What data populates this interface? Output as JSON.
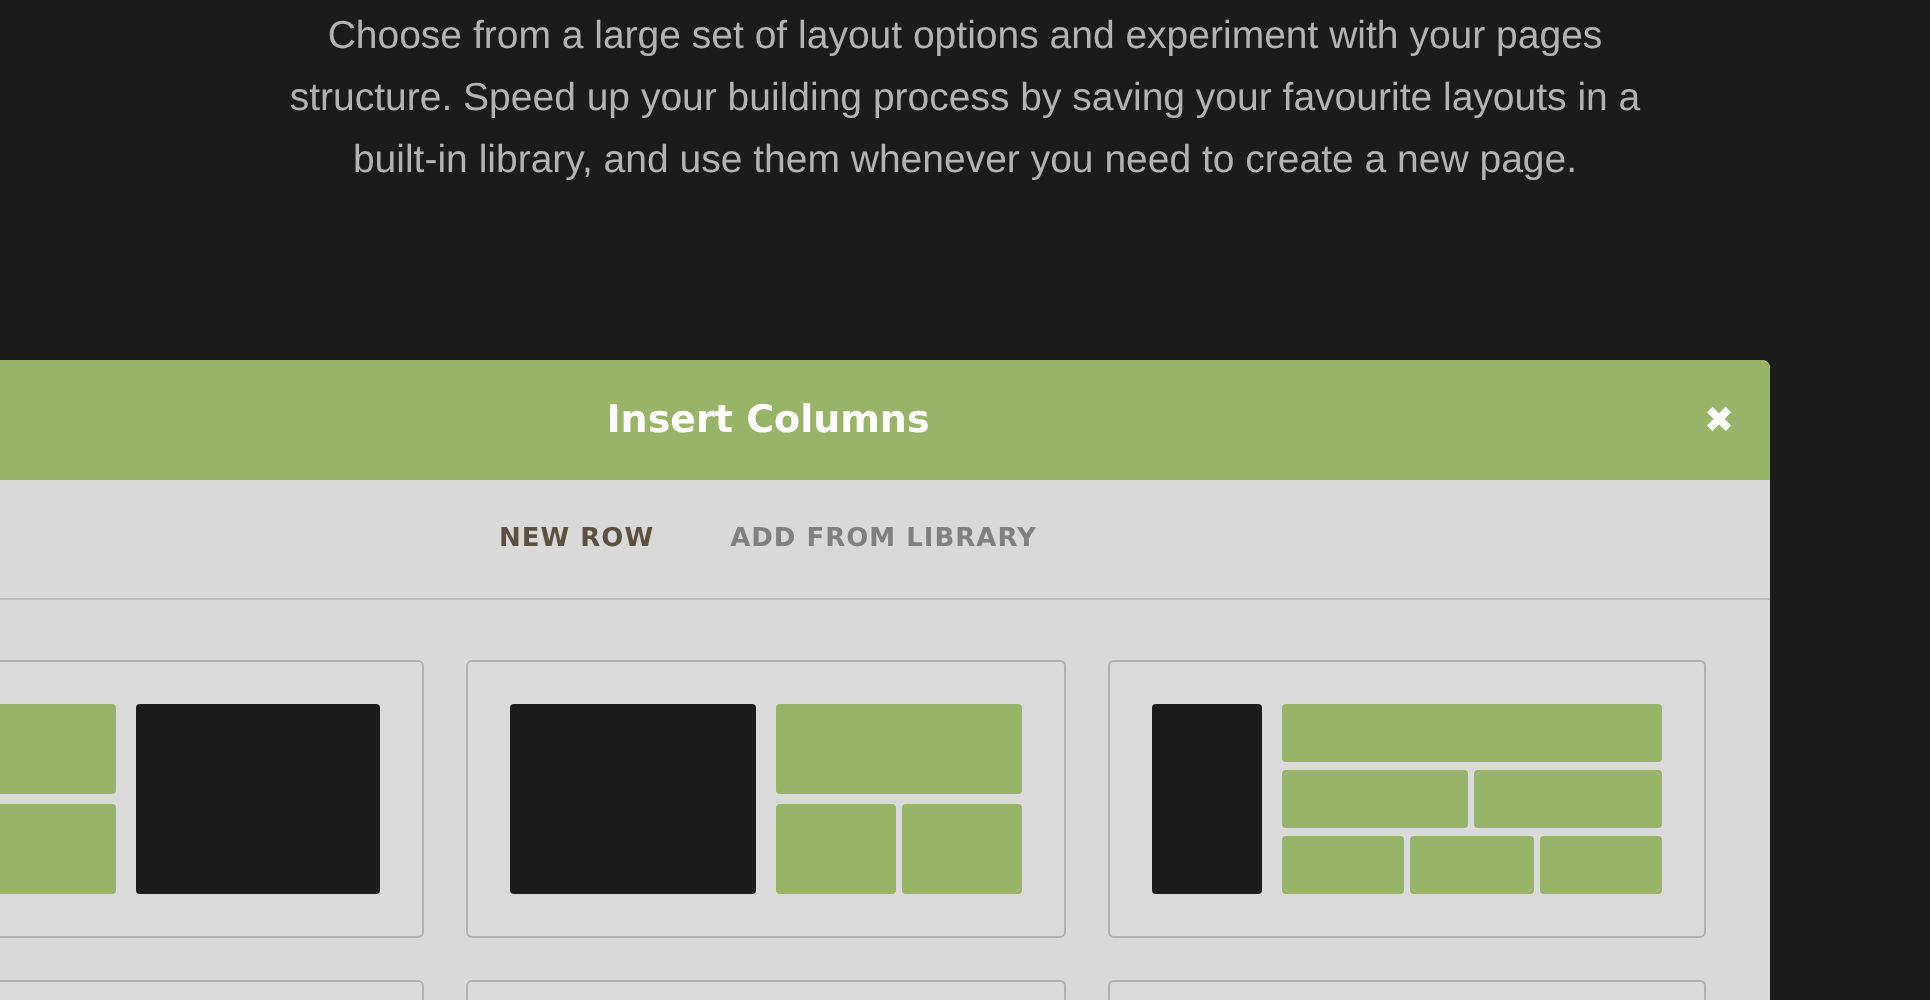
{
  "intro": {
    "lines": [
      "Choose from a large set of layout options and experiment with your pages",
      "structure. Speed up your building process by saving your favourite layouts in a",
      "built-in library, and use them whenever you need to create a new page."
    ]
  },
  "dialog": {
    "title": "Insert Columns",
    "close": "✖",
    "tabs": [
      {
        "label": "NEW ROW",
        "selected": true
      },
      {
        "label": "ADD FROM LIBRARY",
        "selected": false
      }
    ],
    "layouts": [
      {
        "kind": "split-left"
      },
      {
        "kind": "split-right"
      },
      {
        "kind": "sidebar-stack"
      },
      {
        "kind": "blank"
      },
      {
        "kind": "blank"
      },
      {
        "kind": "blank"
      }
    ]
  }
}
